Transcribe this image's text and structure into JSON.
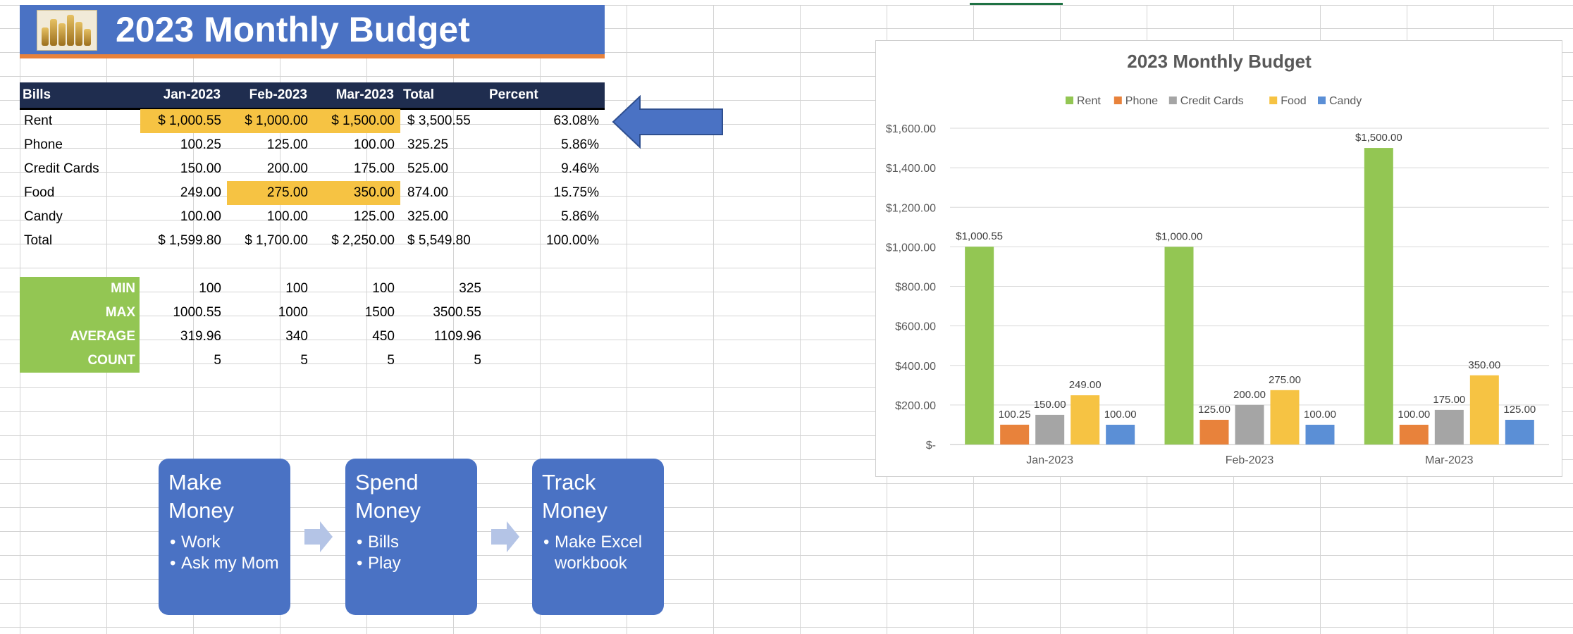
{
  "title": "2023 Monthly Budget",
  "colors": {
    "banner": "#4a72c4",
    "banner_strip": "#e8823b",
    "header": "#1f2d4f",
    "highlight": "#f6c343",
    "stats_label": "#93c653",
    "rent": "#93c653",
    "phone": "#e8823b",
    "credit_cards": "#a5a5a5",
    "food": "#f6c343",
    "candy": "#5b8fd6"
  },
  "table": {
    "headers": [
      "Bills",
      "Jan-2023",
      "Feb-2023",
      "Mar-2023",
      "Total",
      "Percent"
    ],
    "rows": [
      {
        "bill": "Rent",
        "jan": "$ 1,000.55",
        "feb": "$ 1,000.00",
        "mar": "$ 1,500.00",
        "total": "$ 3,500.55",
        "percent": "63.08%"
      },
      {
        "bill": "Phone",
        "jan": "100.25",
        "feb": "125.00",
        "mar": "100.00",
        "total": "325.25",
        "percent": "5.86%"
      },
      {
        "bill": "Credit Cards",
        "jan": "150.00",
        "feb": "200.00",
        "mar": "175.00",
        "total": "525.00",
        "percent": "9.46%"
      },
      {
        "bill": "Food",
        "jan": "249.00",
        "feb": "275.00",
        "mar": "350.00",
        "total": "874.00",
        "percent": "15.75%"
      },
      {
        "bill": "Candy",
        "jan": "100.00",
        "feb": "100.00",
        "mar": "125.00",
        "total": "325.00",
        "percent": "5.86%"
      },
      {
        "bill": "Total",
        "jan": "$ 1,599.80",
        "feb": "$ 1,700.00",
        "mar": "$ 2,250.00",
        "total": "$ 5,549.80",
        "percent": "100.00%"
      }
    ]
  },
  "stats": [
    {
      "label": "MIN",
      "jan": "100",
      "feb": "100",
      "mar": "100",
      "total": "325"
    },
    {
      "label": "MAX",
      "jan": "1000.55",
      "feb": "1000",
      "mar": "1500",
      "total": "3500.55"
    },
    {
      "label": "AVERAGE",
      "jan": "319.96",
      "feb": "340",
      "mar": "450",
      "total": "1109.96"
    },
    {
      "label": "COUNT",
      "jan": "5",
      "feb": "5",
      "mar": "5",
      "total": "5"
    }
  ],
  "flow": [
    {
      "title_line1": "Make",
      "title_line2": "Money",
      "bullets": [
        "Work",
        "Ask my Mom"
      ]
    },
    {
      "title_line1": "Spend",
      "title_line2": "Money",
      "bullets": [
        "Bills",
        "Play"
      ]
    },
    {
      "title_line1": "Track",
      "title_line2": "Money",
      "bullets": [
        "Make Excel workbook"
      ]
    }
  ],
  "chart_data": {
    "type": "bar",
    "title": "2023 Monthly Budget",
    "categories": [
      "Jan-2023",
      "Feb-2023",
      "Mar-2023"
    ],
    "series": [
      {
        "name": "Rent",
        "values": [
          1000.55,
          1000.0,
          1500.0
        ],
        "labels": [
          "$1,000.55",
          "$1,000.00",
          "$1,500.00"
        ],
        "color": "#93c653"
      },
      {
        "name": "Phone",
        "values": [
          100.25,
          125.0,
          100.0
        ],
        "labels": [
          "100.25",
          "125.00",
          "100.00"
        ],
        "color": "#e8823b"
      },
      {
        "name": "Credit Cards",
        "values": [
          150.0,
          200.0,
          175.0
        ],
        "labels": [
          "150.00",
          "200.00",
          "175.00"
        ],
        "color": "#a5a5a5"
      },
      {
        "name": "Food",
        "values": [
          249.0,
          275.0,
          350.0
        ],
        "labels": [
          "249.00",
          "275.00",
          "350.00"
        ],
        "color": "#f6c343"
      },
      {
        "name": "Candy",
        "values": [
          100.0,
          100.0,
          125.0
        ],
        "labels": [
          "100.00",
          "100.00",
          "125.00"
        ],
        "color": "#5b8fd6"
      }
    ],
    "ylim": [
      0,
      1600
    ],
    "yticks": [
      0,
      200,
      400,
      600,
      800,
      1000,
      1200,
      1400,
      1600
    ],
    "ytick_labels": [
      "$-",
      "$200.00",
      "$400.00",
      "$600.00",
      "$800.00",
      "$1,000.00",
      "$1,200.00",
      "$1,400.00",
      "$1,600.00"
    ],
    "legend": "top",
    "grid": true
  }
}
